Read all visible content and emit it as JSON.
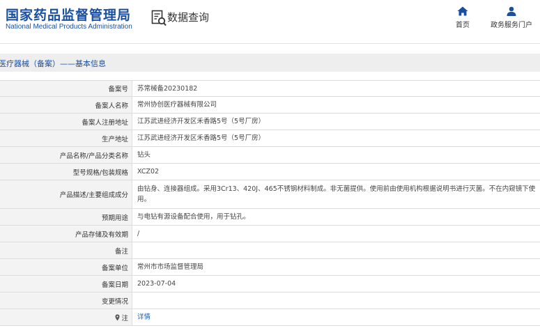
{
  "header": {
    "logo_cn": "国家药品监督管理局",
    "logo_en": "National Medical Products Administration",
    "query_title": "数据查询",
    "nav": {
      "home_label": "首页",
      "service_label": "政务服务门户"
    }
  },
  "section": {
    "title": "医疗器械（备案）——基本信息"
  },
  "info_table": {
    "rows": [
      {
        "label": "备案号",
        "value": "苏常械备20230182"
      },
      {
        "label": "备案人名称",
        "value": "常州协创医疗器械有限公司"
      },
      {
        "label": "备案人注册地址",
        "value": "江苏武进经济开发区禾香路5号（5号厂房）"
      },
      {
        "label": "生产地址",
        "value": "江苏武进经济开发区禾香路5号（5号厂房）"
      },
      {
        "label": "产品名称/产品分类名称",
        "value": "钻头"
      },
      {
        "label": "型号规格/包装规格",
        "value": "XCZ02"
      },
      {
        "label": "产品描述/主要组成成分",
        "value": "由钻身、连接器组成。采用3Cr13、420J、465不锈钢材料制成。非无菌提供。使用前由使用机构根据说明书进行灭菌。不在内窥镜下使用。"
      },
      {
        "label": "预期用途",
        "value": "与电钻有源设备配合使用，用于钻孔。"
      },
      {
        "label": "产品存储及有效期",
        "value": "/"
      },
      {
        "label": "备注",
        "value": ""
      },
      {
        "label": "备案单位",
        "value": "常州市市场监督管理局"
      },
      {
        "label": "备案日期",
        "value": "2023-07-04"
      },
      {
        "label": "变更情况",
        "value": ""
      },
      {
        "label": "注",
        "value": "详情"
      }
    ]
  },
  "colors": {
    "brand_blue": "#1a4fa0",
    "link_blue": "#1a5fb4",
    "label_bg": "#f3f3f3",
    "section_bg": "#eeeeee"
  },
  "icons": [
    "query-doc-icon",
    "home-icon",
    "user-icon",
    "location-pin-icon"
  ]
}
